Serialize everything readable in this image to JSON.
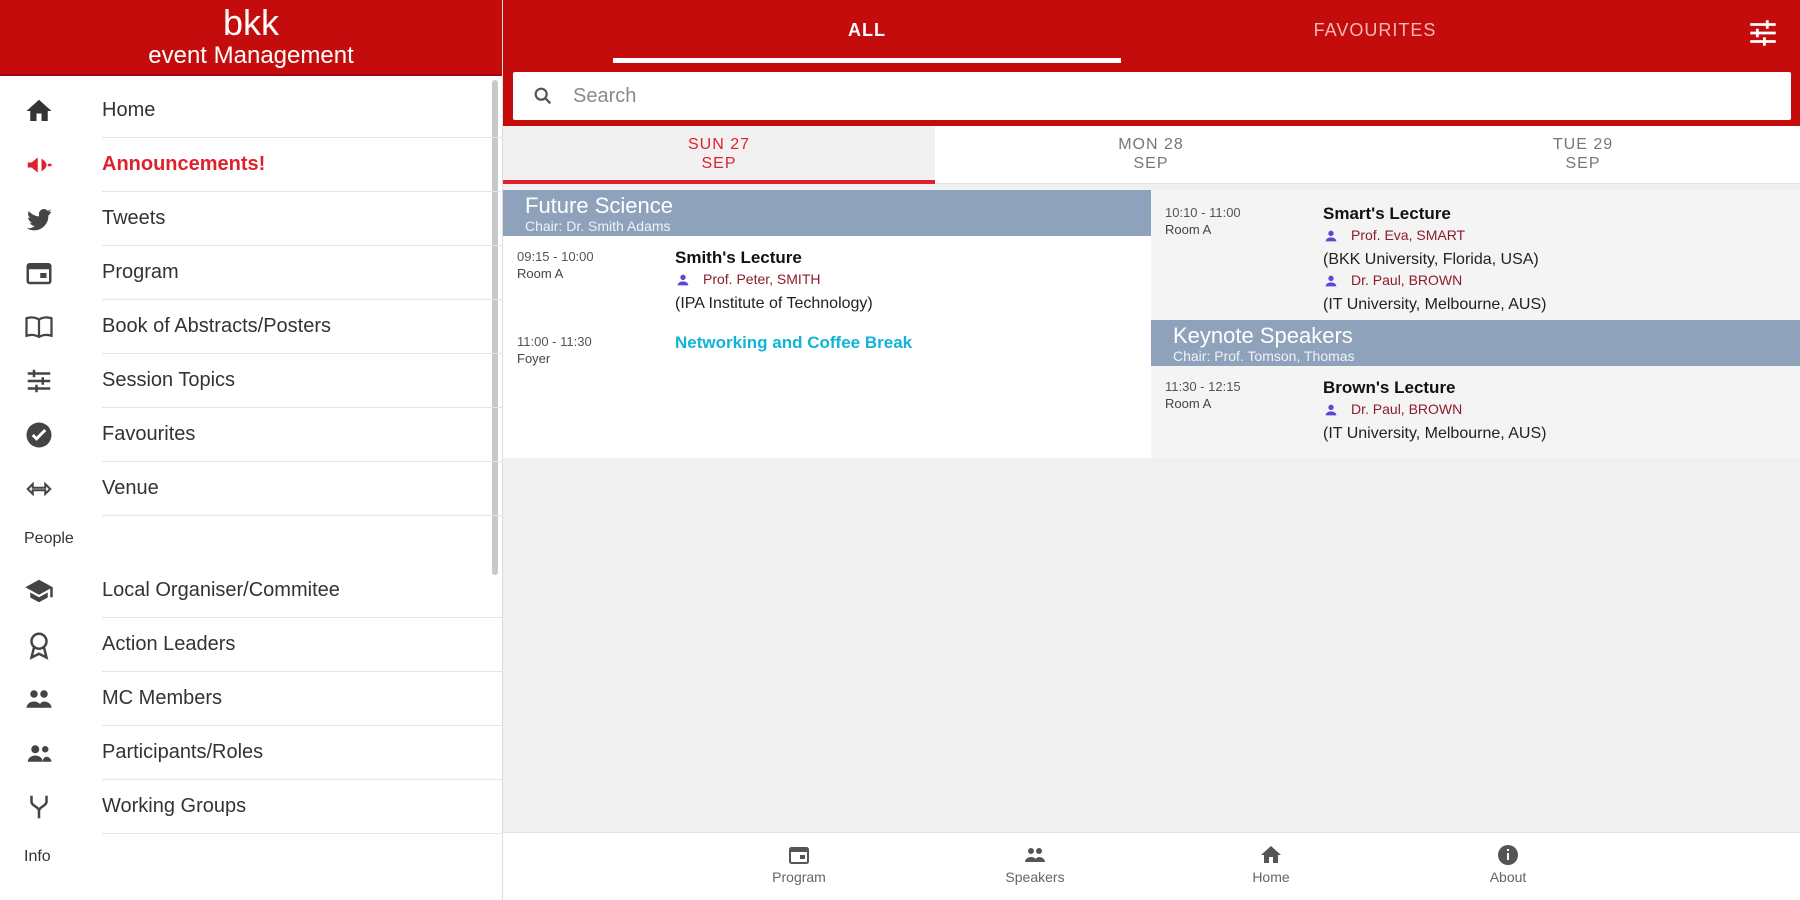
{
  "app": {
    "brand_title": "bkk",
    "brand_subtitle": "event Management"
  },
  "sidebar": {
    "items_top": [
      {
        "label": "Home",
        "icon": "home-icon"
      },
      {
        "label": "Announcements!",
        "icon": "megaphone-icon",
        "active": true
      },
      {
        "label": "Tweets",
        "icon": "twitter-icon"
      },
      {
        "label": "Program",
        "icon": "calendar-icon"
      },
      {
        "label": "Book of Abstracts/Posters",
        "icon": "book-icon"
      },
      {
        "label": "Session Topics",
        "icon": "topics-icon"
      },
      {
        "label": "Favourites",
        "icon": "check-circle-icon"
      },
      {
        "label": "Venue",
        "icon": "venue-icon"
      }
    ],
    "section_people": "People",
    "items_people": [
      {
        "label": "Local Organiser/Commitee",
        "icon": "school-icon"
      },
      {
        "label": "Action Leaders",
        "icon": "award-icon"
      },
      {
        "label": "MC Members",
        "icon": "group-icon"
      },
      {
        "label": "Participants/Roles",
        "icon": "people-icon"
      },
      {
        "label": "Working Groups",
        "icon": "fork-icon"
      }
    ],
    "section_info": "Info"
  },
  "topbar": {
    "tab_all": "ALL",
    "tab_favourites": "FAVOURITES",
    "filter_icon": "tune-icon",
    "search_placeholder": "Search"
  },
  "days": [
    {
      "day": "SUN 27",
      "month": "SEP",
      "active": true
    },
    {
      "day": "MON 28",
      "month": "SEP"
    },
    {
      "day": "TUE 29",
      "month": "SEP"
    }
  ],
  "schedule": {
    "left": {
      "session_title": "Future Science",
      "session_chair": "Chair: Dr. Smith Adams",
      "events": [
        {
          "time": "09:15 - 10:00",
          "room": "Room A",
          "title": "Smith's Lecture",
          "speaker": "Prof. Peter, SMITH",
          "affiliation": "(IPA Institute of Technology)"
        },
        {
          "time": "11:00 - 11:30",
          "room": "Foyer",
          "title": "Networking and Coffee Break"
        }
      ]
    },
    "right": {
      "event1": {
        "time": "10:10 - 11:00",
        "room": "Room A",
        "title": "Smart's Lecture",
        "speaker1": "Prof. Eva, SMART",
        "affiliation1": "(BKK University, Florida, USA)",
        "speaker2": "Dr. Paul, BROWN",
        "affiliation2": "(IT University, Melbourne, AUS)"
      },
      "session_title": "Keynote Speakers",
      "session_chair": "Chair: Prof. Tomson, Thomas",
      "event2": {
        "time": "11:30 - 12:15",
        "room": "Room A",
        "title": "Brown's Lecture",
        "speaker": "Dr. Paul, BROWN",
        "affiliation": "(IT University, Melbourne, AUS)"
      }
    }
  },
  "bottom_nav": [
    {
      "label": "Program",
      "icon": "calendar-icon"
    },
    {
      "label": "Speakers",
      "icon": "speakers-icon"
    },
    {
      "label": "Home",
      "icon": "home-icon"
    },
    {
      "label": "About",
      "icon": "info-icon"
    }
  ],
  "colors": {
    "brand_red": "#c40c0c",
    "active_red": "#e0212c",
    "session_header": "#8ea3bb",
    "break_cyan": "#10b4d6",
    "speaker_icon": "#5b48d6"
  }
}
